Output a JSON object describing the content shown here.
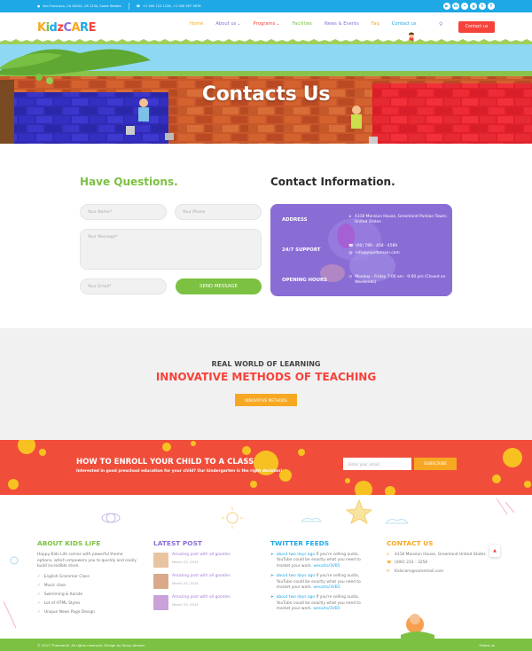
{
  "topbar": {
    "address": "San Francisco, CA 94102, US 1234, Some Streets",
    "phone": "+1 000 123 1234, +1 000 567 5678",
    "socials": [
      "youtube-icon",
      "linkedin-icon",
      "flickr-icon",
      "googleplus-icon",
      "twitter-icon",
      "facebook-icon"
    ]
  },
  "header": {
    "logo": [
      "K",
      "i",
      "d",
      "z",
      "C",
      "A",
      "R",
      "E"
    ],
    "nav": [
      {
        "label": "Home",
        "color": "#f7a823"
      },
      {
        "label": "About us",
        "color": "#8c6fd6",
        "dropdown": true
      },
      {
        "label": "Programs",
        "color": "#f6423a",
        "dropdown": true
      },
      {
        "label": "Facilities",
        "color": "#7cc142"
      },
      {
        "label": "News & Events",
        "color": "#8c6fd6"
      },
      {
        "label": "Faq",
        "color": "#f7a823"
      },
      {
        "label": "Contact us",
        "color": "#1fa8e6"
      }
    ],
    "cta": "Contact us"
  },
  "banner": {
    "title": "Contacts Us"
  },
  "form": {
    "heading": "Have Questions.",
    "name_placeholder": "Your Name*",
    "phone_placeholder": "Your Phone",
    "message_placeholder": "Your Message*",
    "email_placeholder": "Your Email*",
    "submit": "SEND MESSAGE"
  },
  "contact_info": {
    "heading": "Contact Information.",
    "rows": [
      {
        "label": "ADDRESS",
        "lines": [
          "4318 Mansion House, Greenland Parklan Tower, United States"
        ]
      },
      {
        "label": "24/7 SUPPORT",
        "lines": [
          "(00) 789 - 458 - 4589",
          "info@yourdomain.com"
        ]
      },
      {
        "label": "OPENING HOURS",
        "lines": [
          "Monday - Friday 7:00 am - 9:00 pm (Closed on Weekends)"
        ]
      }
    ]
  },
  "learning": {
    "subtitle": "REAL WORLD OF LEARNING",
    "title": "INNOVATIVE METHODS OF TEACHING",
    "button": "INNOVATIVE METHODS"
  },
  "enroll": {
    "title": "HOW TO ENROLL YOUR CHILD TO A CLASS",
    "subtitle": "Interested in good preschool education for your child? Our kindergarten is the right decision!",
    "email_placeholder": "Enter your email",
    "button": "SUBSCRIBE"
  },
  "footer": {
    "about": {
      "heading": "ABOUT KIDS LIFE",
      "color": "#7cc142",
      "description": "Happy Kids Life comes with powerful theme options, which empowers you to quickly and easily build incredible store.",
      "items": [
        "English Grammar Class",
        "Music class",
        "Swimming & Karate",
        "Lot of HTML Styles",
        "Unique News Page Design"
      ]
    },
    "posts": {
      "heading": "LATEST POST",
      "color": "#8c6fd6",
      "items": [
        {
          "title": "Amazing post with all goodies",
          "date": "March 23, 2014"
        },
        {
          "title": "Amazing post with all goodies",
          "date": "March 23, 2014"
        },
        {
          "title": "Amazing post with all goodies",
          "date": "March 23, 2014"
        }
      ]
    },
    "twitter": {
      "heading": "TWITTER FEEDS",
      "color": "#1fa8e6",
      "items": [
        {
          "time": "about two days ago",
          "text": "If you're selling audio, YouTube could be exactly what you need to market your work.",
          "link": "wesa/to/3VB5"
        },
        {
          "time": "about two days ago",
          "text": "If you're selling audio, YouTube could be exactly what you need to market your work.",
          "link": "wesa/to/3VB5"
        },
        {
          "time": "about two days ago",
          "text": "If you're selling audio, YouTube could be exactly what you need to market your work.",
          "link": "wesa/to/3VB5"
        }
      ]
    },
    "contact": {
      "heading": "CONTACT US",
      "color": "#f7a823",
      "address": "4318 Mansion House, Greenland United States",
      "phone": "(000) 233 - 3256",
      "email": "Kidscare@somemail.com"
    }
  },
  "bottombar": {
    "copyright": "© 2017 Themomill. All rights reserved. Design by Tonsy Ahmed",
    "follow": "Follow us"
  }
}
